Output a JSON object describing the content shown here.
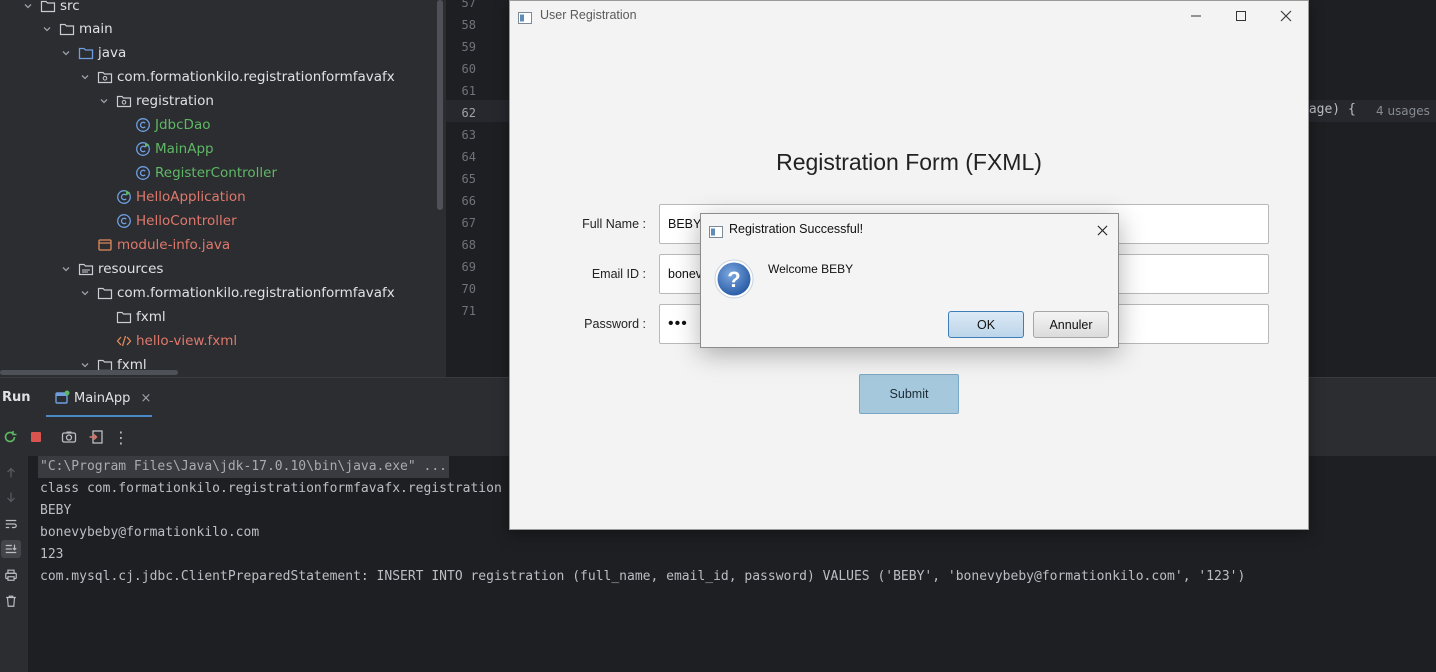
{
  "project_tree": {
    "items": [
      {
        "label": "src",
        "icon": "folder-icon",
        "color": "normal"
      },
      {
        "label": "main",
        "icon": "folder-icon",
        "color": "normal"
      },
      {
        "label": "java",
        "icon": "source-folder-icon",
        "color": "normal"
      },
      {
        "label": "com.formationkilo.registrationformfavafx",
        "icon": "package-icon",
        "color": "normal"
      },
      {
        "label": "registration",
        "icon": "package-icon",
        "color": "normal"
      },
      {
        "label": "JdbcDao",
        "icon": "class-icon",
        "color": "green"
      },
      {
        "label": "MainApp",
        "icon": "runnable-class-icon",
        "color": "green"
      },
      {
        "label": "RegisterController",
        "icon": "class-icon",
        "color": "green"
      },
      {
        "label": "HelloApplication",
        "icon": "runnable-class-icon",
        "color": "red"
      },
      {
        "label": "HelloController",
        "icon": "class-icon",
        "color": "red"
      },
      {
        "label": "module-info.java",
        "icon": "module-icon",
        "color": "red"
      },
      {
        "label": "resources",
        "icon": "resources-folder-icon",
        "color": "normal"
      },
      {
        "label": "com.formationkilo.registrationformfavafx",
        "icon": "folder-icon",
        "color": "normal"
      },
      {
        "label": "fxml",
        "icon": "folder-icon",
        "color": "normal"
      },
      {
        "label": "hello-view.fxml",
        "icon": "xml-file-icon",
        "color": "red"
      },
      {
        "label": "fxml",
        "icon": "folder-icon",
        "color": "normal"
      }
    ]
  },
  "editor": {
    "line_numbers": [
      "57",
      "58",
      "59",
      "60",
      "61",
      "62",
      "63",
      "64",
      "65",
      "66",
      "67",
      "68",
      "69",
      "70",
      "71"
    ],
    "current_line": "62",
    "visible_code": "sage) {",
    "usages_hint": "4 usages"
  },
  "run_panel": {
    "title": "Run",
    "tab_label": "MainApp",
    "console_lines": [
      "\"C:\\Program Files\\Java\\jdk-17.0.10\\bin\\java.exe\" ...",
      "class com.formationkilo.registrationformfavafx.registration",
      "BEBY",
      "bonevybeby@formationkilo.com",
      "123",
      "com.mysql.cj.jdbc.ClientPreparedStatement: INSERT INTO registration (full_name, email_id, password) VALUES ('BEBY', 'bonevybeby@formationkilo.com', '123')"
    ]
  },
  "fx_window": {
    "title": "User Registration",
    "heading": "Registration Form (FXML)",
    "full_name_label": "Full Name :",
    "full_name_value": "BEBY",
    "email_label": "Email ID :",
    "email_value": "bonev",
    "password_label": "Password :",
    "password_value": "•••",
    "submit_label": "Submit"
  },
  "alert": {
    "title": "Registration Successful!",
    "message": "Welcome BEBY",
    "ok_label": "OK",
    "cancel_label": "Annuler"
  },
  "colors": {
    "accent": "#4a88c7",
    "tree_green": "#5fb865",
    "tree_red": "#e0786c",
    "ide_bg": "#1e1f22",
    "panel_bg": "#2b2d30"
  }
}
